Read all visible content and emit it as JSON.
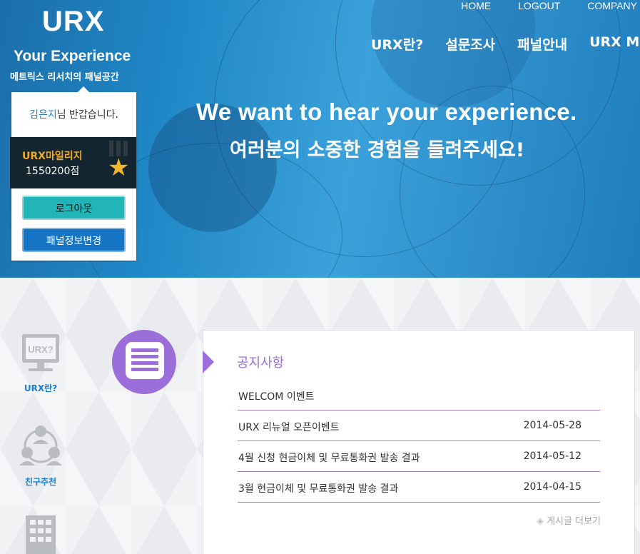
{
  "brand": {
    "logo": "URX",
    "tagline": "Your Experience",
    "subtagline": "메트릭스 리서치의 패널공간"
  },
  "top_nav": [
    "HOME",
    "LOGOUT",
    "COMPANY"
  ],
  "main_nav": [
    "URX란?",
    "설문조사",
    "패널안내",
    "URX Mall"
  ],
  "hero": {
    "headline": "We want to hear your experience.",
    "subheadline": "여러분의 소중한 경험을 들려주세요!"
  },
  "login_card": {
    "username": "김은지",
    "greeting_suffix": "님 반갑습니다.",
    "mileage_label": "URX마일리지",
    "mileage_value": "1550200점",
    "logout_button": "로그아웃",
    "edit_button": "패널정보변경"
  },
  "sidebar": {
    "items": [
      {
        "label": "URX란?",
        "icon": "monitor-icon",
        "icon_text": "URX?"
      },
      {
        "label": "친구추천",
        "icon": "people-network-icon"
      },
      {
        "label": "",
        "icon": "building-icon"
      }
    ]
  },
  "notice": {
    "title": "공지사항",
    "featured": "WELCOM 이벤트",
    "items": [
      {
        "title": "URX 리뉴얼 오픈이벤트",
        "date": "2014-05-28"
      },
      {
        "title": "4월 신청 현금이체 및 무료통화권 발송 결과",
        "date": "2014-05-12"
      },
      {
        "title": "3월 현금이체 및 무료통화권 발송 결과",
        "date": "2014-04-15"
      }
    ],
    "more_label": "게시글 더보기"
  },
  "colors": {
    "accent_purple": "#9b6ed9",
    "link_blue": "#1d7fd0",
    "mileage_gold": "#f1a826",
    "button_teal": "#21b5b8",
    "button_blue": "#1675c4"
  }
}
